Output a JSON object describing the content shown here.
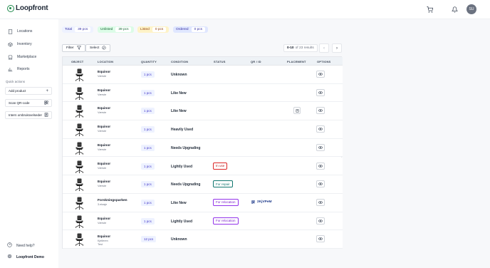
{
  "app": {
    "logo_text": "Loopfront",
    "avatar_initials": "SU"
  },
  "header": {
    "cart_icon": "cart-icon",
    "bell_icon": "bell-icon"
  },
  "sidebar": {
    "items": [
      {
        "label": "Locations",
        "icon": "building-icon"
      },
      {
        "label": "Inventory",
        "icon": "box-icon"
      },
      {
        "label": "Marketplace",
        "icon": "store-icon"
      },
      {
        "label": "Reports",
        "icon": "chart-icon"
      }
    ],
    "quick_actions_title": "Quick actions",
    "quick_actions": [
      {
        "label": "Add product",
        "icon": "plus-icon"
      },
      {
        "label": "Scan QR-code",
        "icon": "qr-icon"
      },
      {
        "label": "Intern ombruksvelseder",
        "icon": "doc-icon"
      }
    ],
    "help_label": "Need help?",
    "org_label": "Loopfront Demo"
  },
  "stats": [
    {
      "label": "Total",
      "count": "39 pcs",
      "bg": "#eef2ff",
      "fg": "#3730a3"
    },
    {
      "label": "Unlisted",
      "count": "39 pcs",
      "bg": "#dcfce7",
      "fg": "#166534"
    },
    {
      "label": "Listed",
      "count": "0 pcs",
      "bg": "#fef3c7",
      "fg": "#92400e"
    },
    {
      "label": "Ordered",
      "count": "0 pcs",
      "bg": "#e0e7ff",
      "fg": "#3730a3"
    }
  ],
  "toolbar": {
    "filter_label": "Filter",
    "select_label": "Select"
  },
  "pagination": {
    "range": "0-10",
    "of_text": "of 23 results"
  },
  "table": {
    "columns": [
      "OBJECT",
      "LOCATION",
      "QUANTITY",
      "CONDITION",
      "STATUS",
      "QR / ID",
      "PLACEMENT",
      "OPTIONS"
    ],
    "rows": [
      {
        "name": "Equinor",
        "loc1": "Værste",
        "loc2": "",
        "qty": "1 pcs",
        "condition": "Unknown",
        "status": "",
        "qr": "",
        "placement": false
      },
      {
        "name": "Equinor",
        "loc1": "Værste",
        "loc2": "",
        "qty": "1 pcs",
        "condition": "Like New",
        "status": "",
        "qr": "",
        "placement": false
      },
      {
        "name": "Equinor",
        "loc1": "Værste",
        "loc2": "",
        "qty": "1 pcs",
        "condition": "Like New",
        "status": "",
        "qr": "",
        "placement": true
      },
      {
        "name": "Equinor",
        "loc1": "Værste",
        "loc2": "",
        "qty": "1 pcs",
        "condition": "Heavily Used",
        "status": "",
        "qr": "",
        "placement": false
      },
      {
        "name": "Equinor",
        "loc1": "Værste",
        "loc2": "",
        "qty": "1 pcs",
        "condition": "Needs Upgrading",
        "status": "",
        "qr": "",
        "placement": false
      },
      {
        "name": "Equinor",
        "loc1": "Værste",
        "loc2": "",
        "qty": "1 pcs",
        "condition": "Lightly Used",
        "status": "In use",
        "qr": "",
        "placement": false
      },
      {
        "name": "Equinor",
        "loc1": "Værste",
        "loc2": "",
        "qty": "1 pcs",
        "condition": "Needs Upgrading",
        "status": "For repair",
        "qr": "",
        "placement": false
      },
      {
        "name": "Forskningsparken",
        "loc1": "3.etasje",
        "loc2": "",
        "qty": "1 pcs",
        "condition": "Like New",
        "status": "For relocation",
        "qr": "2KjVPeM",
        "placement": false
      },
      {
        "name": "Equinor",
        "loc1": "Værste",
        "loc2": "",
        "qty": "1 pcs",
        "condition": "Lightly Used",
        "status": "For relocation",
        "qr": "",
        "placement": false
      },
      {
        "name": "Equinor",
        "loc1": "Kjelleren",
        "loc2": "Test",
        "qty": "12 pcs",
        "condition": "Unknown",
        "status": "",
        "qr": "",
        "placement": false
      }
    ]
  },
  "status_colors": {
    "In use": {
      "border": "#dc2626",
      "fg": "#b91c1c"
    },
    "For repair": {
      "border": "#0f766e",
      "fg": "#0f766e"
    },
    "For relocation": {
      "border": "#9333ea",
      "fg": "#7e22ce"
    }
  }
}
